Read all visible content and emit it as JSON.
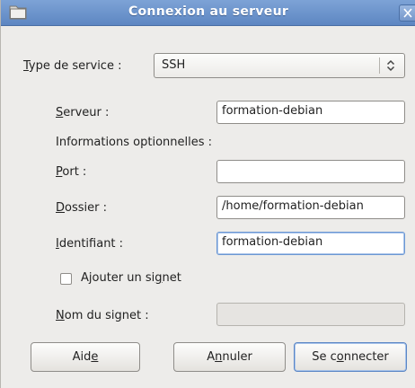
{
  "window": {
    "title": "Connexion au serveur",
    "accent_color": "#6b94cc"
  },
  "service": {
    "label_mnemonic": "T",
    "label_rest": "ype de service :",
    "value": "SSH"
  },
  "server": {
    "label_mnemonic": "S",
    "label_rest": "erveur :",
    "value": "formation-debian"
  },
  "optional_heading": "Informations optionnelles :",
  "port": {
    "label_mnemonic": "P",
    "label_rest": "ort :",
    "value": ""
  },
  "folder": {
    "label_mnemonic": "D",
    "label_rest": "ossier :",
    "value": "/home/formation-debian"
  },
  "user": {
    "label_mnemonic": "I",
    "label_rest": "dentifiant :",
    "value": "formation-debian"
  },
  "bookmark_checkbox": {
    "label_before": "Ajouter un si",
    "label_mnemonic": "g",
    "label_after": "net",
    "checked": false
  },
  "bookmark_name": {
    "label_mnemonic": "N",
    "label_rest": "om du signet :",
    "value": ""
  },
  "buttons": {
    "help": {
      "before": "Aid",
      "mnemonic": "e",
      "after": ""
    },
    "cancel": {
      "before": "A",
      "mnemonic": "n",
      "after": "nuler"
    },
    "connect": {
      "before": "Se c",
      "mnemonic": "o",
      "after": "nnecter"
    }
  },
  "icons": {
    "title": "folder-icon",
    "close": "close-icon",
    "combo": "updown-arrows-icon"
  }
}
